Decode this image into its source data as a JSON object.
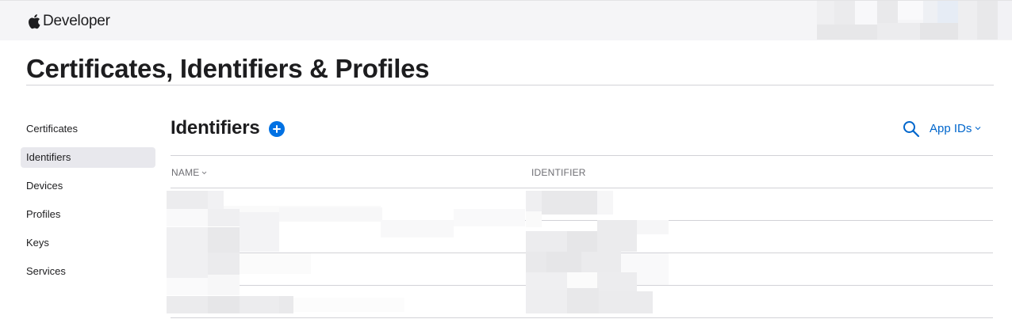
{
  "topbar": {
    "brand_label": "Developer",
    "brand_icon": "apple-logo-icon"
  },
  "page": {
    "title": "Certificates, Identifiers & Profiles"
  },
  "sidebar": {
    "items": [
      {
        "label": "Certificates",
        "active": false
      },
      {
        "label": "Identifiers",
        "active": true
      },
      {
        "label": "Devices",
        "active": false
      },
      {
        "label": "Profiles",
        "active": false
      },
      {
        "label": "Keys",
        "active": false
      },
      {
        "label": "Services",
        "active": false
      }
    ]
  },
  "main": {
    "title": "Identifiers",
    "add_icon": "plus-circle-icon",
    "search_icon": "search-icon",
    "filter_label": "App IDs",
    "table": {
      "columns": [
        "NAME",
        "IDENTIFIER"
      ],
      "sort_column": "NAME",
      "row_count": 4,
      "rows_redacted": true
    }
  },
  "colors": {
    "accent": "#0071e3",
    "link": "#0066cc",
    "text": "#1d1d1f",
    "secondary_text": "#6e6e73",
    "topbar_bg": "#f5f5f7",
    "active_item_bg": "#e8e8ed",
    "divider": "#d2d2d7"
  }
}
